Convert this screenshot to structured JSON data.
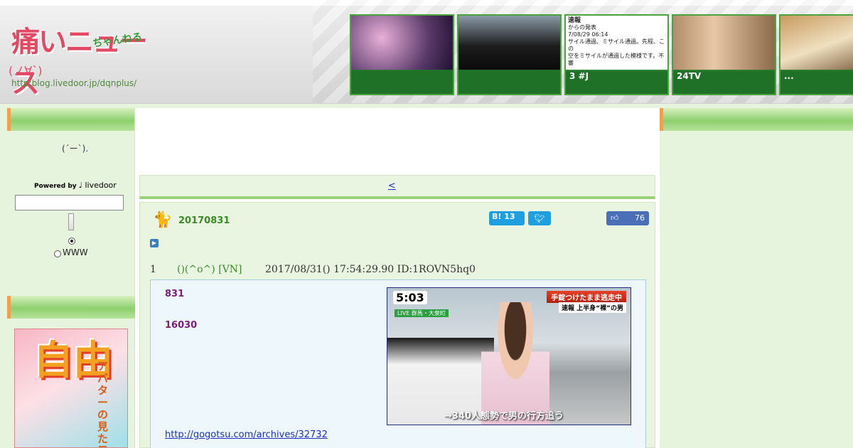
{
  "header": {
    "logo_main": "痛いニュース",
    "logo_sub": "ちゃんねる",
    "logo_face": "(ノ∀`)",
    "logo_url": "http:blog.livedoor.jp/dqnplus/",
    "thumbs": [
      {
        "label": ""
      },
      {
        "label": ""
      },
      {
        "label": "3 #J",
        "img_title": "速報",
        "img_lines": [
          "からの発表",
          "7/08/29 06:14",
          "サイル通過、ミサイル通過。先程、この",
          "空をミサイルが通過した模様です。不審"
        ]
      },
      {
        "label": "24TV"
      },
      {
        "label": "..."
      }
    ]
  },
  "sidebar": {
    "face_icon": "(´ー`)",
    "face_dot": ".",
    "powered_by": "Powered by",
    "powered_brand": "livedoor",
    "search_placeholder": "",
    "radio_www": "WWW",
    "banner_big": "自由",
    "banner_small": "アバターの見た目"
  },
  "main": {
    "nav_prev": "<",
    "post_date": "20170831",
    "hatena_label": "B!",
    "hatena_count": "13",
    "twitter_icon": "twitter-icon",
    "like_count": "76",
    "res": {
      "num": "1",
      "name": "()(^o^) [VN]",
      "meta": "2017/08/31() 17:54:29.90 ID:1ROVN5hq0",
      "line1": "831",
      "line2": "16030",
      "link": "http://gogotsu.com/archives/32732"
    },
    "news_img": {
      "time": "5:03",
      "live": "LIVE 群馬・大泉町",
      "cap1": "手錠つけたまま逃走中",
      "cap2": "速報 上半身“裸”の男",
      "bottom": "→340人態勢で男の行方追う"
    }
  }
}
